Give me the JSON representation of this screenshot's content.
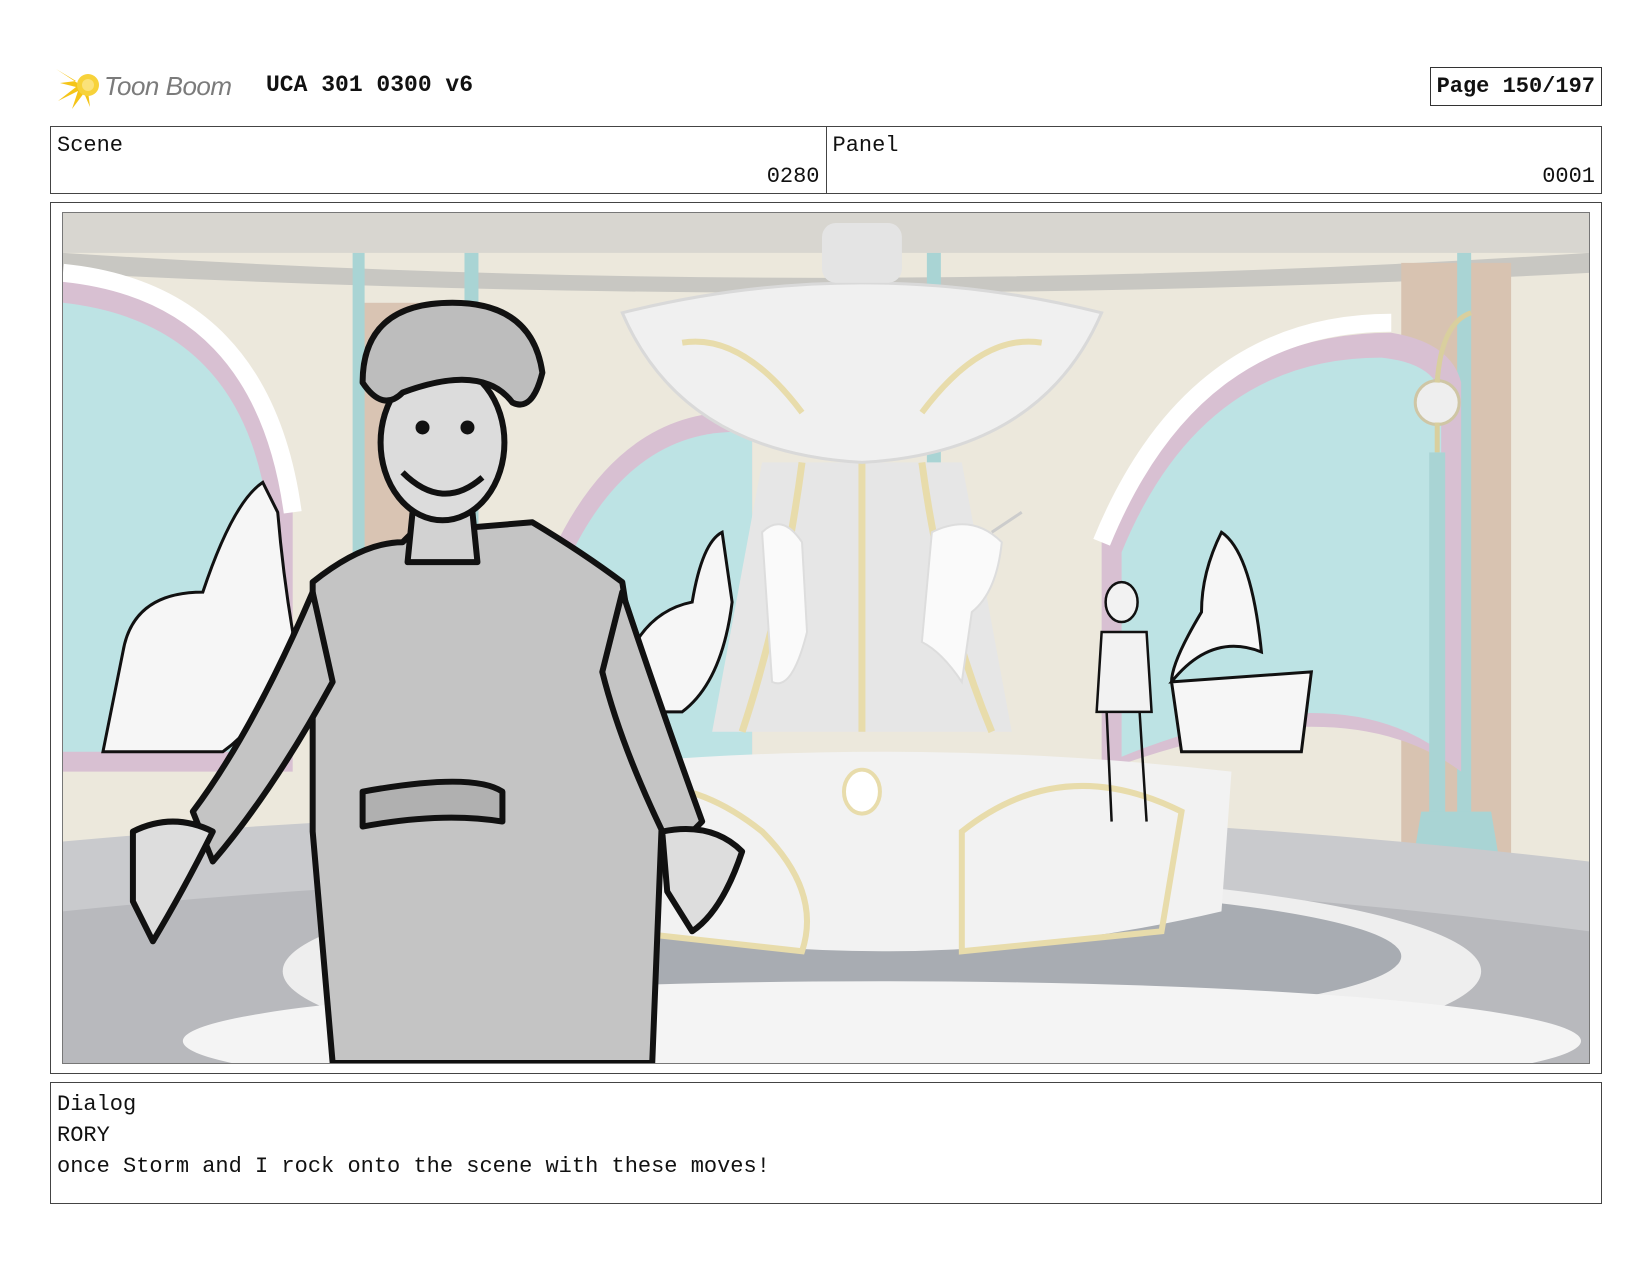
{
  "header": {
    "logo_text": "Toon Boom",
    "title": "UCA 301 0300 v6",
    "page_label": "Page",
    "page_value": "150/197"
  },
  "scene": {
    "label": "Scene",
    "value": "0280"
  },
  "panel": {
    "label": "Panel",
    "value": "0001"
  },
  "dialog": {
    "label": "Dialog",
    "speaker": "RORY",
    "line": "once Storm and I rock onto the scene with these moves!"
  },
  "colors": {
    "logo_yellow": "#f5c518",
    "wall": "#ece8dc",
    "window_glass": "#bde3e4",
    "fountain": "#eeeeee",
    "gold_trim": "#e8dcab",
    "floor": "#c9cacd",
    "character_fill": "#c4c4c4"
  },
  "illustration": {
    "description_icon": "storyboard-sketch",
    "elements": [
      "fountain",
      "unicorn-statues",
      "horses",
      "girls",
      "boy-character",
      "arched-windows",
      "lamp-post"
    ]
  }
}
